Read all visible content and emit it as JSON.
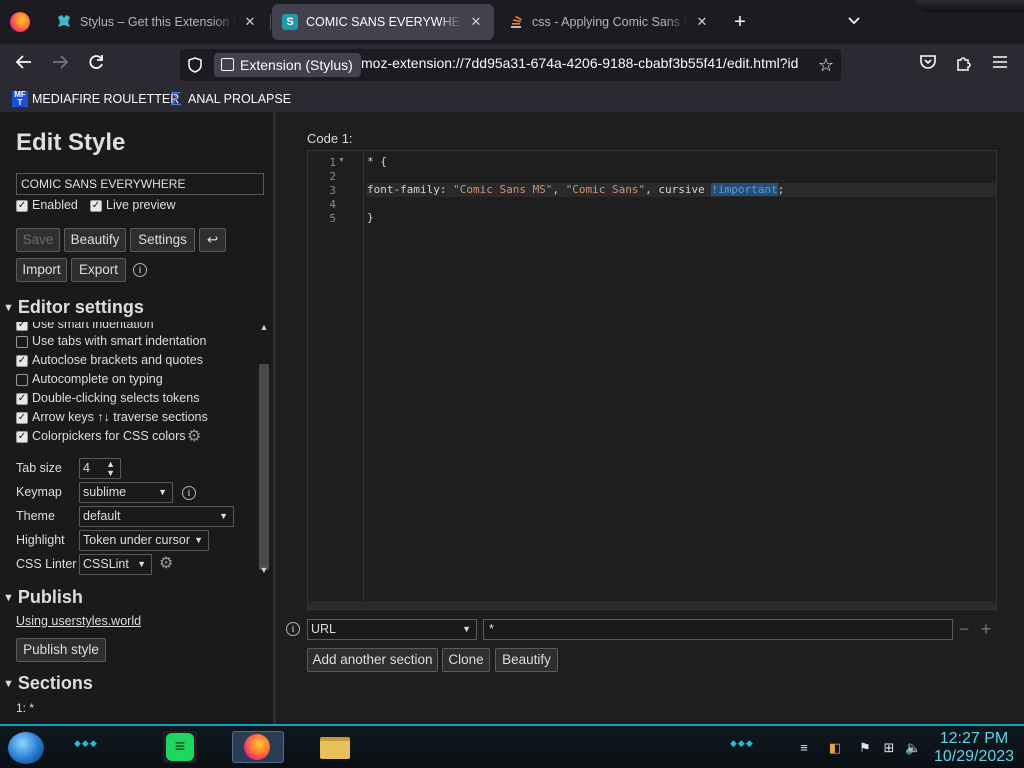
{
  "tabs": [
    {
      "title": "Stylus – Get this Extension for",
      "icon": "stylus-icon",
      "active": false
    },
    {
      "title": "COMIC SANS EVERYWHERE - St",
      "icon": "stylus-s-icon",
      "active": true
    },
    {
      "title": "css - Applying Comic Sans Ma",
      "icon": "stackoverflow-icon",
      "active": false
    }
  ],
  "tab_close_glyph": "✕",
  "newtab_glyph": "+",
  "nav": {
    "identity_label": "Extension (Stylus)",
    "url": "moz-extension://7dd95a31-674a-4206-9188-cbabf3b55f41/edit.html?id"
  },
  "bookmarks": [
    {
      "label": "MEDIAFIRE ROULETTER",
      "icon_text": "MF T"
    },
    {
      "label": "ANAL PROLAPSE",
      "icon_text": "Σ"
    }
  ],
  "sidebar": {
    "heading": "Edit Style",
    "style_name": "COMIC SANS EVERYWHERE",
    "enabled_label": "Enabled",
    "enabled": true,
    "live_preview_label": "Live preview",
    "live_preview": true,
    "buttons": {
      "save": "Save",
      "beautify": "Beautify",
      "settings": "Settings",
      "undo": "↩",
      "import": "Import",
      "export": "Export"
    },
    "editor_settings_title": "Editor settings",
    "editor_checkboxes": [
      {
        "label": "Use smart indentation",
        "checked": true
      },
      {
        "label": "Use tabs with smart indentation",
        "checked": false
      },
      {
        "label": "Autoclose brackets and quotes",
        "checked": true
      },
      {
        "label": "Autocomplete on typing",
        "checked": false
      },
      {
        "label": "Double-clicking selects tokens",
        "checked": true
      },
      {
        "label": "Arrow keys ↑↓ traverse sections",
        "checked": true
      },
      {
        "label": "Colorpickers for CSS colors",
        "checked": true
      }
    ],
    "tab_size_label": "Tab size",
    "tab_size": "4",
    "keymap_label": "Keymap",
    "keymap": "sublime",
    "theme_label": "Theme",
    "theme": "default",
    "highlight_label": "Highlight",
    "highlight": "Token under cursor",
    "linter_label": "CSS Linter",
    "linter": "CSSLint",
    "publish_title": "Publish",
    "publish_link": "Using userstyles.world",
    "publish_button": "Publish style",
    "sections_title": "Sections",
    "sections_item": "1: *"
  },
  "editor": {
    "code_label": "Code 1:",
    "line_numbers": [
      "1",
      "2",
      "3",
      "4",
      "5"
    ],
    "lines": [
      "* {",
      "",
      "font-family: \"Comic Sans MS\", \"Comic Sans\", cursive !important;",
      "",
      "}"
    ],
    "line3_parts": {
      "prop": "font-family: ",
      "str1": "\"Comic Sans MS\"",
      "sep1": ", ",
      "str2": "\"Comic Sans\"",
      "sep2": ", cursive ",
      "important": "!important",
      "end": ";"
    },
    "active_line": 3,
    "applies_to_type": "URL",
    "applies_to_value": "*",
    "buttons": {
      "add_section": "Add another section",
      "clone": "Clone",
      "beautify": "Beautify"
    }
  },
  "taskbar": {
    "time": "12:27 PM",
    "date": "10/29/2023"
  },
  "colors": {
    "accent_cyan": "#5fd7e8",
    "string": "#ce9178",
    "keyword_important": "#569cd6"
  }
}
